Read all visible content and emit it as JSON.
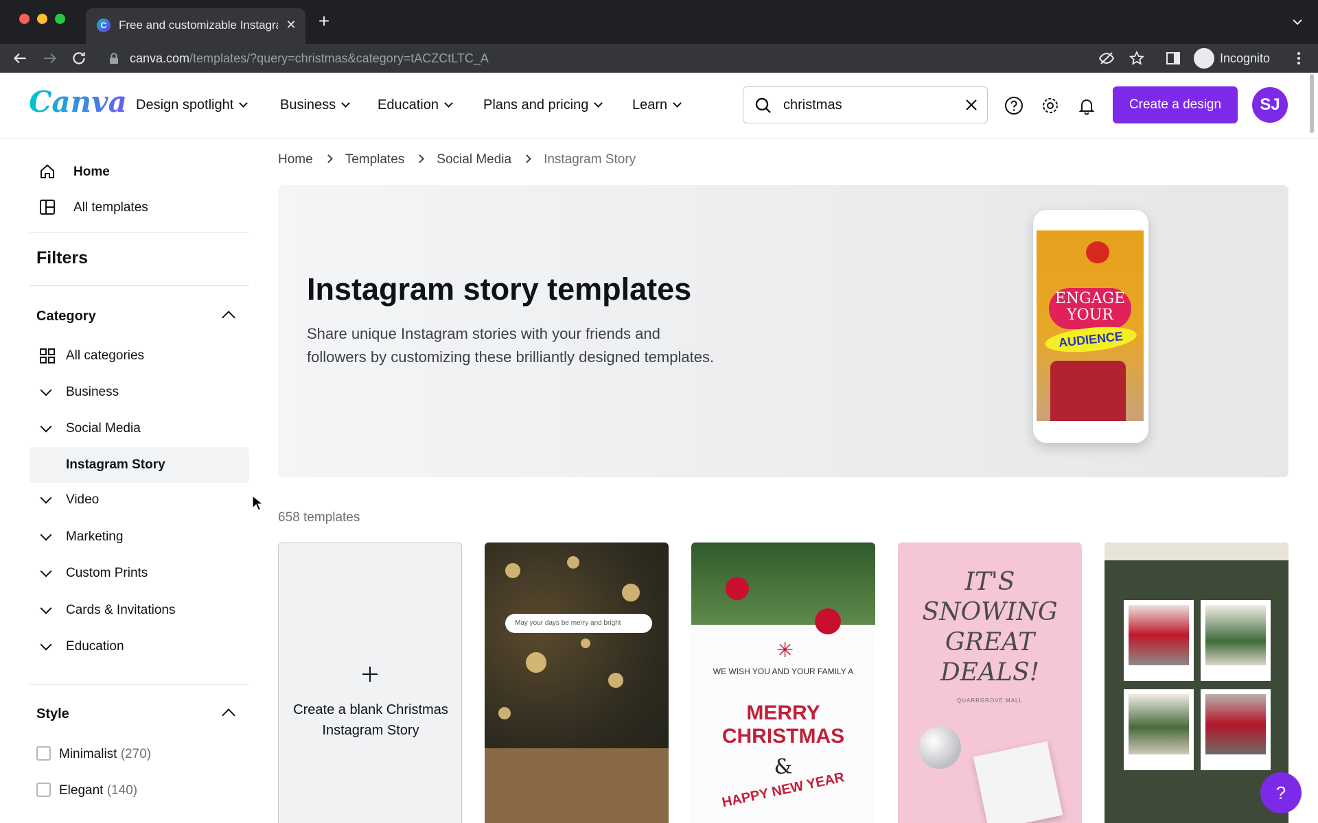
{
  "browser": {
    "tab_title": "Free and customizable Instagram",
    "url_host": "canva.com",
    "url_path": "/templates/?query=christmas&category=tACZCtLTC_A",
    "profile_label": "Incognito"
  },
  "header": {
    "logo": "Canva",
    "nav": [
      "Design spotlight",
      "Business",
      "Education",
      "Plans and pricing",
      "Learn"
    ],
    "search_value": "christmas",
    "create_label": "Create a design",
    "avatar_initials": "SJ",
    "brand_color": "#7d2ae8"
  },
  "sidebar": {
    "home": "Home",
    "all_templates": "All templates",
    "filters_title": "Filters",
    "category_title": "Category",
    "all_categories": "All categories",
    "categories": [
      "Business",
      "Social Media",
      "Instagram Story",
      "Video",
      "Marketing",
      "Custom Prints",
      "Cards & Invitations",
      "Education"
    ],
    "style_title": "Style",
    "styles": [
      {
        "label": "Minimalist",
        "count": "(270)"
      },
      {
        "label": "Elegant",
        "count": "(140)"
      }
    ]
  },
  "breadcrumb": [
    "Home",
    "Templates",
    "Social Media",
    "Instagram Story"
  ],
  "hero": {
    "title": "Instagram story templates",
    "description": "Share unique Instagram stories with your friends and followers by customizing these brilliantly designed templates.",
    "phone_text_1": "ENGAGE YOUR",
    "phone_text_2": "AUDIENCE"
  },
  "templates_count": "658 templates",
  "cards": {
    "blank_label": "Create a blank Christmas Instagram Story",
    "card2_search": "May your days be merry and bright",
    "card3_small": "WE WISH YOU AND YOUR FAMILY A",
    "card3_big": "MERRY CHRISTMAS",
    "card3_amp": "&",
    "card3_hny": "HAPPY NEW YEAR",
    "card4_text": "IT'S SNOWING GREAT DEALS!",
    "card4_sub": "QUARRGROVE MALL"
  },
  "help_label": "?"
}
